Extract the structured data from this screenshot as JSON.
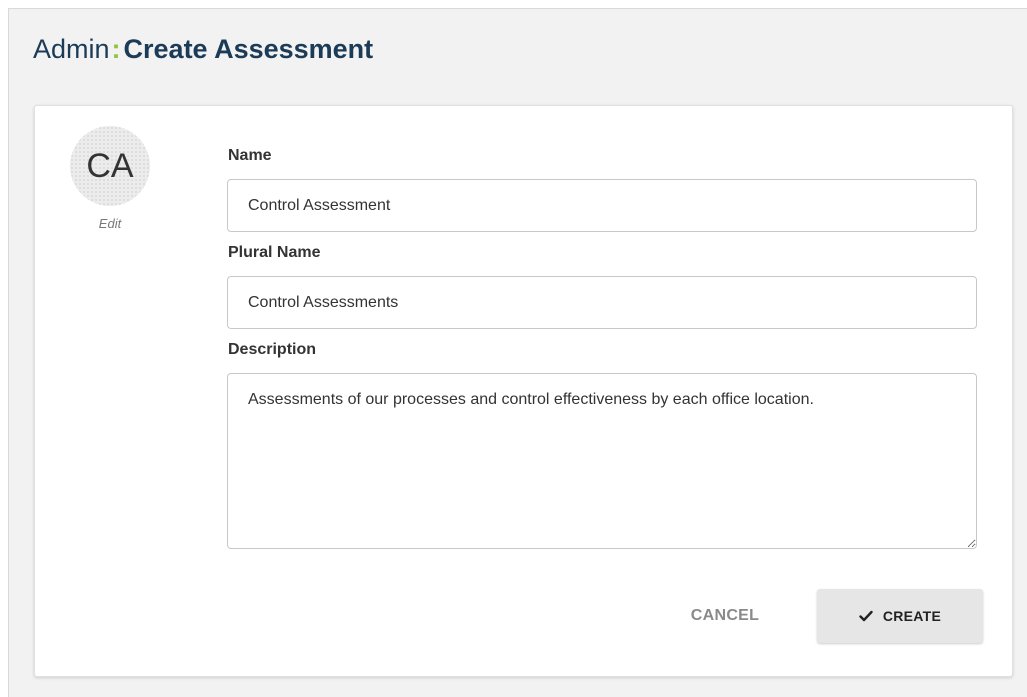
{
  "header": {
    "breadcrumb_root": "Admin",
    "separator": ":",
    "title": "Create Assessment"
  },
  "avatar": {
    "initials": "CA",
    "edit_label": "Edit"
  },
  "form": {
    "name": {
      "label": "Name",
      "value": "Control Assessment"
    },
    "plural_name": {
      "label": "Plural Name",
      "value": "Control Assessments"
    },
    "description": {
      "label": "Description",
      "value": "Assessments of our processes and control effectiveness by each office location."
    }
  },
  "actions": {
    "cancel_label": "CANCEL",
    "create_label": "CREATE",
    "create_icon": "check-icon"
  },
  "colors": {
    "title": "#1b3b57",
    "accent": "#8dc63f"
  }
}
